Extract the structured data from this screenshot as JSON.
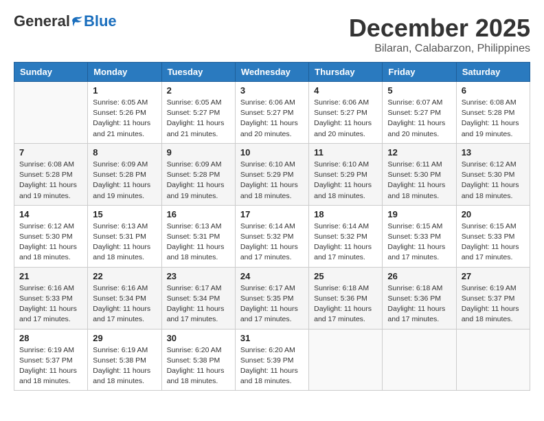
{
  "header": {
    "logo_general": "General",
    "logo_blue": "Blue",
    "month_title": "December 2025",
    "location": "Bilaran, Calabarzon, Philippines"
  },
  "weekdays": [
    "Sunday",
    "Monday",
    "Tuesday",
    "Wednesday",
    "Thursday",
    "Friday",
    "Saturday"
  ],
  "weeks": [
    [
      {
        "day": "",
        "info": ""
      },
      {
        "day": "1",
        "info": "Sunrise: 6:05 AM\nSunset: 5:26 PM\nDaylight: 11 hours\nand 21 minutes."
      },
      {
        "day": "2",
        "info": "Sunrise: 6:05 AM\nSunset: 5:27 PM\nDaylight: 11 hours\nand 21 minutes."
      },
      {
        "day": "3",
        "info": "Sunrise: 6:06 AM\nSunset: 5:27 PM\nDaylight: 11 hours\nand 20 minutes."
      },
      {
        "day": "4",
        "info": "Sunrise: 6:06 AM\nSunset: 5:27 PM\nDaylight: 11 hours\nand 20 minutes."
      },
      {
        "day": "5",
        "info": "Sunrise: 6:07 AM\nSunset: 5:27 PM\nDaylight: 11 hours\nand 20 minutes."
      },
      {
        "day": "6",
        "info": "Sunrise: 6:08 AM\nSunset: 5:28 PM\nDaylight: 11 hours\nand 19 minutes."
      }
    ],
    [
      {
        "day": "7",
        "info": "Sunrise: 6:08 AM\nSunset: 5:28 PM\nDaylight: 11 hours\nand 19 minutes."
      },
      {
        "day": "8",
        "info": "Sunrise: 6:09 AM\nSunset: 5:28 PM\nDaylight: 11 hours\nand 19 minutes."
      },
      {
        "day": "9",
        "info": "Sunrise: 6:09 AM\nSunset: 5:28 PM\nDaylight: 11 hours\nand 19 minutes."
      },
      {
        "day": "10",
        "info": "Sunrise: 6:10 AM\nSunset: 5:29 PM\nDaylight: 11 hours\nand 18 minutes."
      },
      {
        "day": "11",
        "info": "Sunrise: 6:10 AM\nSunset: 5:29 PM\nDaylight: 11 hours\nand 18 minutes."
      },
      {
        "day": "12",
        "info": "Sunrise: 6:11 AM\nSunset: 5:30 PM\nDaylight: 11 hours\nand 18 minutes."
      },
      {
        "day": "13",
        "info": "Sunrise: 6:12 AM\nSunset: 5:30 PM\nDaylight: 11 hours\nand 18 minutes."
      }
    ],
    [
      {
        "day": "14",
        "info": "Sunrise: 6:12 AM\nSunset: 5:30 PM\nDaylight: 11 hours\nand 18 minutes."
      },
      {
        "day": "15",
        "info": "Sunrise: 6:13 AM\nSunset: 5:31 PM\nDaylight: 11 hours\nand 18 minutes."
      },
      {
        "day": "16",
        "info": "Sunrise: 6:13 AM\nSunset: 5:31 PM\nDaylight: 11 hours\nand 18 minutes."
      },
      {
        "day": "17",
        "info": "Sunrise: 6:14 AM\nSunset: 5:32 PM\nDaylight: 11 hours\nand 17 minutes."
      },
      {
        "day": "18",
        "info": "Sunrise: 6:14 AM\nSunset: 5:32 PM\nDaylight: 11 hours\nand 17 minutes."
      },
      {
        "day": "19",
        "info": "Sunrise: 6:15 AM\nSunset: 5:33 PM\nDaylight: 11 hours\nand 17 minutes."
      },
      {
        "day": "20",
        "info": "Sunrise: 6:15 AM\nSunset: 5:33 PM\nDaylight: 11 hours\nand 17 minutes."
      }
    ],
    [
      {
        "day": "21",
        "info": "Sunrise: 6:16 AM\nSunset: 5:33 PM\nDaylight: 11 hours\nand 17 minutes."
      },
      {
        "day": "22",
        "info": "Sunrise: 6:16 AM\nSunset: 5:34 PM\nDaylight: 11 hours\nand 17 minutes."
      },
      {
        "day": "23",
        "info": "Sunrise: 6:17 AM\nSunset: 5:34 PM\nDaylight: 11 hours\nand 17 minutes."
      },
      {
        "day": "24",
        "info": "Sunrise: 6:17 AM\nSunset: 5:35 PM\nDaylight: 11 hours\nand 17 minutes."
      },
      {
        "day": "25",
        "info": "Sunrise: 6:18 AM\nSunset: 5:36 PM\nDaylight: 11 hours\nand 17 minutes."
      },
      {
        "day": "26",
        "info": "Sunrise: 6:18 AM\nSunset: 5:36 PM\nDaylight: 11 hours\nand 17 minutes."
      },
      {
        "day": "27",
        "info": "Sunrise: 6:19 AM\nSunset: 5:37 PM\nDaylight: 11 hours\nand 18 minutes."
      }
    ],
    [
      {
        "day": "28",
        "info": "Sunrise: 6:19 AM\nSunset: 5:37 PM\nDaylight: 11 hours\nand 18 minutes."
      },
      {
        "day": "29",
        "info": "Sunrise: 6:19 AM\nSunset: 5:38 PM\nDaylight: 11 hours\nand 18 minutes."
      },
      {
        "day": "30",
        "info": "Sunrise: 6:20 AM\nSunset: 5:38 PM\nDaylight: 11 hours\nand 18 minutes."
      },
      {
        "day": "31",
        "info": "Sunrise: 6:20 AM\nSunset: 5:39 PM\nDaylight: 11 hours\nand 18 minutes."
      },
      {
        "day": "",
        "info": ""
      },
      {
        "day": "",
        "info": ""
      },
      {
        "day": "",
        "info": ""
      }
    ]
  ]
}
